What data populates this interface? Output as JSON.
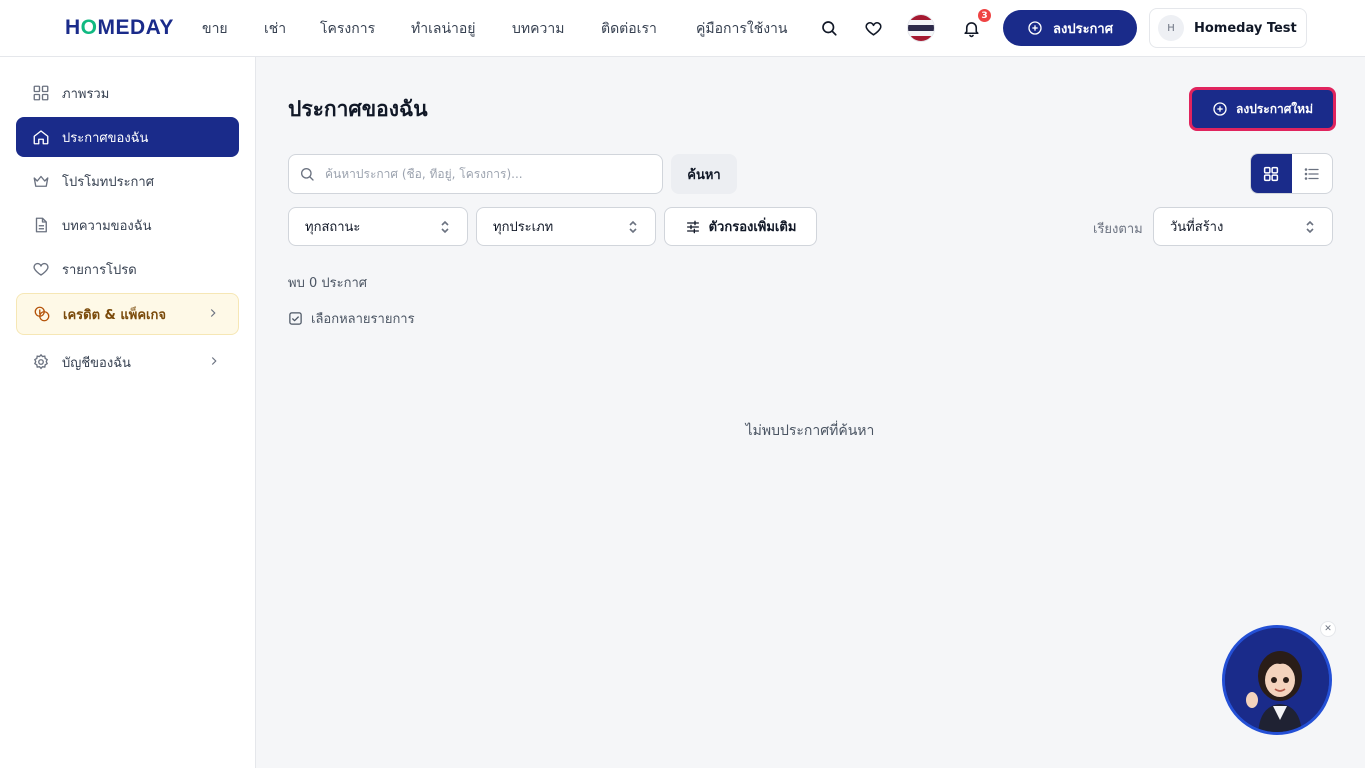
{
  "brand": {
    "logo_pre": "H",
    "logo_o": "O",
    "logo_post": "MEDAY"
  },
  "nav": {
    "items": [
      {
        "label": "ขาย"
      },
      {
        "label": "เช่า"
      },
      {
        "label": "โครงการ"
      },
      {
        "label": "ทำเลน่าอยู่"
      },
      {
        "label": "บทความ"
      },
      {
        "label": "ติดต่อเรา"
      },
      {
        "label": "คู่มือการใช้งาน"
      }
    ],
    "notification_count": "3",
    "post_label": "ลงประกาศ",
    "user_initial": "H",
    "user_name": "Homeday Test",
    "flag_colors": [
      "#a51931",
      "#f4f5f8",
      "#2d2a4a",
      "#f4f5f8",
      "#a51931"
    ]
  },
  "sidebar": {
    "items": [
      {
        "label": "ภาพรวม",
        "icon": "dashboard-icon"
      },
      {
        "label": "ประกาศของฉัน",
        "icon": "home-icon",
        "active": true
      },
      {
        "label": "โปรโมทประกาศ",
        "icon": "crown-icon"
      },
      {
        "label": "บทความของฉัน",
        "icon": "document-icon"
      },
      {
        "label": "รายการโปรด",
        "icon": "heart-icon"
      },
      {
        "label": "เครดิต & แพ็คเกจ",
        "icon": "coins-icon"
      },
      {
        "label": "บัญชีของฉัน",
        "icon": "gear-icon"
      }
    ]
  },
  "main": {
    "title": "ประกาศของฉัน",
    "new_button": "ลงประกาศใหม่",
    "search": {
      "placeholder": "ค้นหาประกาศ (ชื่อ, ที่อยู่, โครงการ)...",
      "value": "",
      "button": "ค้นหา"
    },
    "filters": {
      "status": "ทุกสถานะ",
      "type": "ทุกประเภท",
      "more": "ตัวกรองเพิ่มเติม"
    },
    "sort": {
      "label": "เรียงตาม",
      "value": "วันที่สร้าง"
    },
    "result_count": "พบ 0 ประกาศ",
    "multi_select": "เลือกหลายรายการ",
    "empty_message": "ไม่พบประกาศที่ค้นหา",
    "view_mode": "grid"
  },
  "colors": {
    "primary": "#1a2b8a",
    "accent": "#10b981",
    "highlight": "#e0245e",
    "badge": "#ef4444"
  }
}
